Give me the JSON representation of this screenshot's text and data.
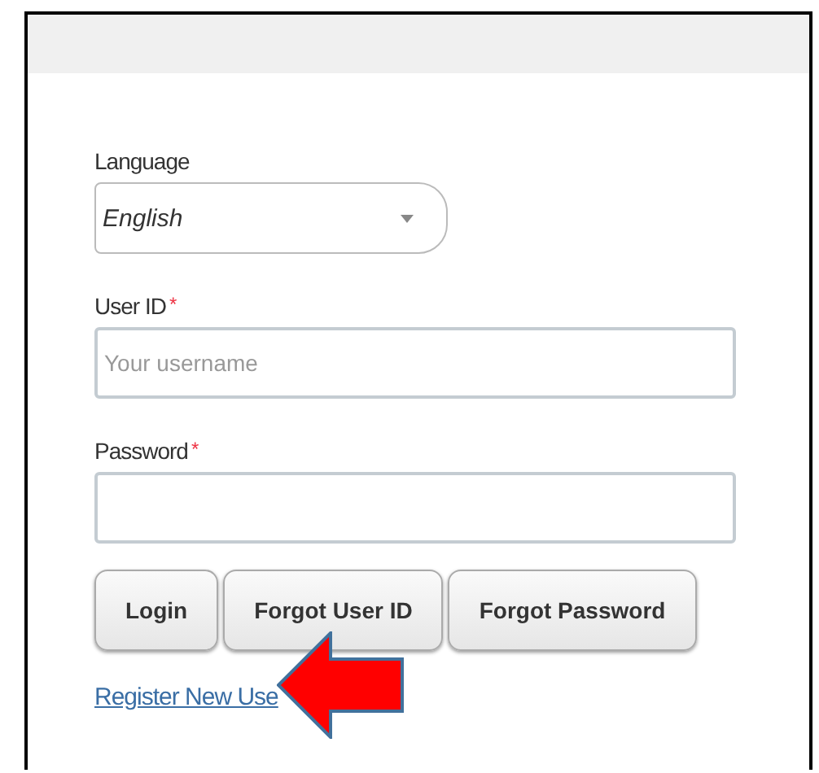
{
  "form": {
    "language": {
      "label": "Language",
      "value": "English"
    },
    "fields": [
      {
        "label": "User ID",
        "required_mark": "*",
        "placeholder": "Your username"
      },
      {
        "label": "Password",
        "required_mark": "*"
      }
    ],
    "buttons": [
      "Login",
      "Forgot User ID",
      "Forgot Password"
    ],
    "link": "Register New Use"
  }
}
